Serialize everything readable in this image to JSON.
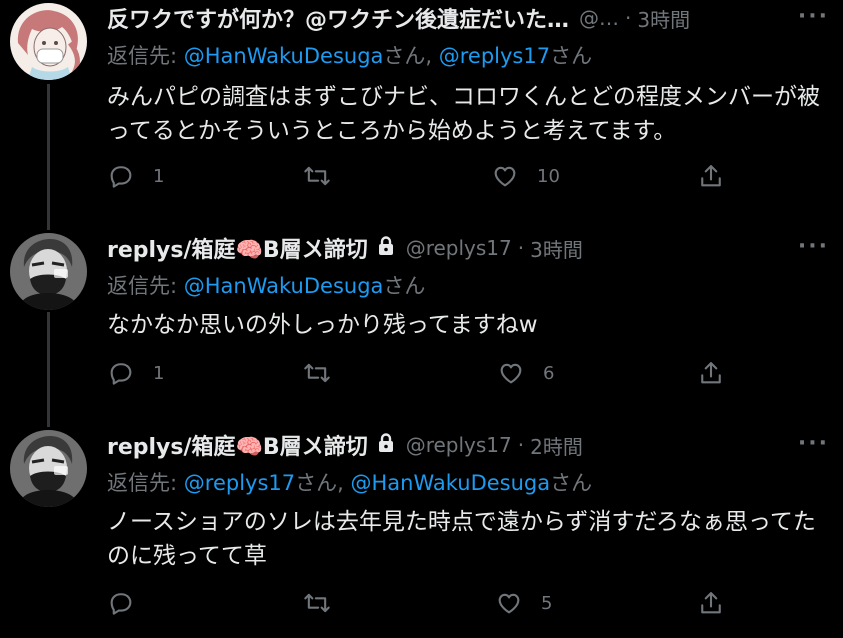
{
  "tweets": [
    {
      "name": "反ワクですが何か？@ワクチン後遺症だいた…",
      "handle": "@…",
      "dot": "·",
      "time": "3時間",
      "more": "···",
      "reply_prefix": "返信先: ",
      "mention1": "@HanWakuDesuga",
      "san1": "さん, ",
      "mention2": "@replys17",
      "san2": "さん",
      "text": "みんパピの調査はまずこびナビ、コロワくんとどの程度メンバーが被ってるとかそういうところから始めようと考えてます。",
      "reply_count": "1",
      "retweet_count": "",
      "like_count": "10"
    },
    {
      "name": "replys/箱庭🧠B層〤諦切",
      "handle": "@replys17",
      "dot": "·",
      "time": "3時間",
      "more": "···",
      "reply_prefix": "返信先: ",
      "mention1": "@HanWakuDesuga",
      "san1": "さん",
      "text": "なかなか思いの外しっかり残ってますねw",
      "reply_count": "1",
      "retweet_count": "",
      "like_count": "6"
    },
    {
      "name": "replys/箱庭🧠B層〤諦切",
      "handle": "@replys17",
      "dot": "·",
      "time": "2時間",
      "more": "···",
      "reply_prefix": "返信先: ",
      "mention1": "@replys17",
      "san1": "さん, ",
      "mention2": "@HanWakuDesuga",
      "san2": "さん",
      "text": "ノースショアのソレは去年見た時点で遠からず消すだろなぁ思ってたのに残ってて草",
      "reply_count": "",
      "retweet_count": "",
      "like_count": "5"
    }
  ],
  "colors": {
    "background": "#000000",
    "text": "#e7e9ea",
    "muted": "#71767b",
    "mention": "#1d9bf0",
    "thread_line": "#333639"
  },
  "icons": [
    "reply-icon",
    "retweet-icon",
    "like-icon",
    "share-icon",
    "lock-icon",
    "more-icon"
  ]
}
